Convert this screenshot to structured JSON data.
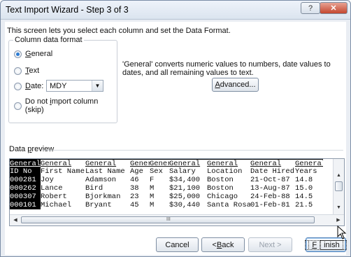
{
  "window": {
    "title": "Text Import Wizard - Step 3 of 3",
    "help_glyph": "?",
    "close_glyph": "✕"
  },
  "description": "This screen lets you select each column and set the Data Format.",
  "column_format": {
    "legend": "Column data format",
    "options": [
      {
        "pre": "",
        "u": "G",
        "post": "eneral",
        "checked": true
      },
      {
        "pre": "",
        "u": "T",
        "post": "ext",
        "checked": false
      },
      {
        "pre": "",
        "u": "D",
        "post": "ate:",
        "checked": false
      },
      {
        "pre": "Do not ",
        "u": "i",
        "post": "mport column (skip)",
        "checked": false
      }
    ],
    "date_value": "MDY"
  },
  "general_description": "'General' converts numeric values to numbers, date values to dates, and all remaining values to text.",
  "advanced_button": {
    "u": "A",
    "post": "dvanced..."
  },
  "preview": {
    "label_pre": "Data ",
    "label_u": "p",
    "label_post": "review",
    "headers": [
      "General",
      "General",
      "General",
      "General",
      "General",
      "General",
      "General",
      "General",
      "General"
    ],
    "rows": [
      [
        "ID No",
        "First Name",
        "Last Name",
        "Age",
        "Sex",
        "Salary",
        "Location",
        "Date Hired",
        "Years"
      ],
      [
        "000281",
        "Joy",
        "Adamson",
        "46",
        "F",
        "$34,400",
        "Boston",
        "21-Oct-87",
        "14.8"
      ],
      [
        "000262",
        "Lance",
        "Bird",
        "38",
        "M",
        "$21,100",
        "Boston",
        "13-Aug-87",
        "15.0"
      ],
      [
        "000307",
        "Robert",
        "Bjorkman",
        "23",
        "M",
        "$25,000",
        "Chicago",
        "24-Feb-88",
        "14.5"
      ],
      [
        "000101",
        "Michael",
        "Bryant",
        "45",
        "M",
        "$30,440",
        "Santa Rosa",
        "01-Feb-81",
        "21.5"
      ]
    ],
    "grip_glyph": "III"
  },
  "buttons": {
    "cancel": "Cancel",
    "back_pre": "< ",
    "back_u": "B",
    "back_post": "ack",
    "next": "Next >",
    "finish_u": "F",
    "finish_post": "inish"
  }
}
